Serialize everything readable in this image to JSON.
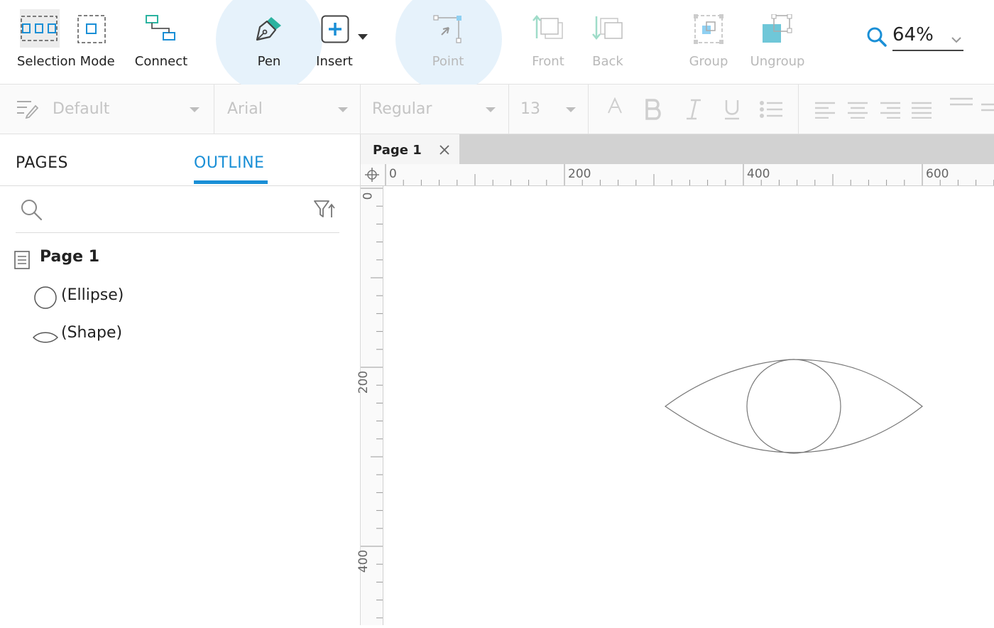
{
  "toolbar": {
    "selection_mode": "Selection Mode",
    "connect": "Connect",
    "pen": "Pen",
    "insert": "Insert",
    "point": "Point",
    "front": "Front",
    "back": "Back",
    "group": "Group",
    "ungroup": "Ungroup",
    "zoom": "64%"
  },
  "format": {
    "style": "Default",
    "font": "Arial",
    "weight": "Regular",
    "size": "13"
  },
  "panel": {
    "tab_pages": "PAGES",
    "tab_outline": "OUTLINE",
    "active_tab": "OUTLINE",
    "tree": [
      {
        "label": "Page 1",
        "icon": "page-icon"
      },
      {
        "label": "(Ellipse)",
        "icon": "ellipse-icon"
      },
      {
        "label": "(Shape)",
        "icon": "shape-icon"
      }
    ]
  },
  "canvas": {
    "page_tab": "Page 1",
    "ruler_h": [
      "0",
      "200",
      "400",
      "600"
    ],
    "ruler_v": [
      "0",
      "200",
      "400"
    ]
  },
  "colors": {
    "accent": "#1a8fd6",
    "teal": "#2bb3a0",
    "disabled": "#b9b9b9"
  }
}
